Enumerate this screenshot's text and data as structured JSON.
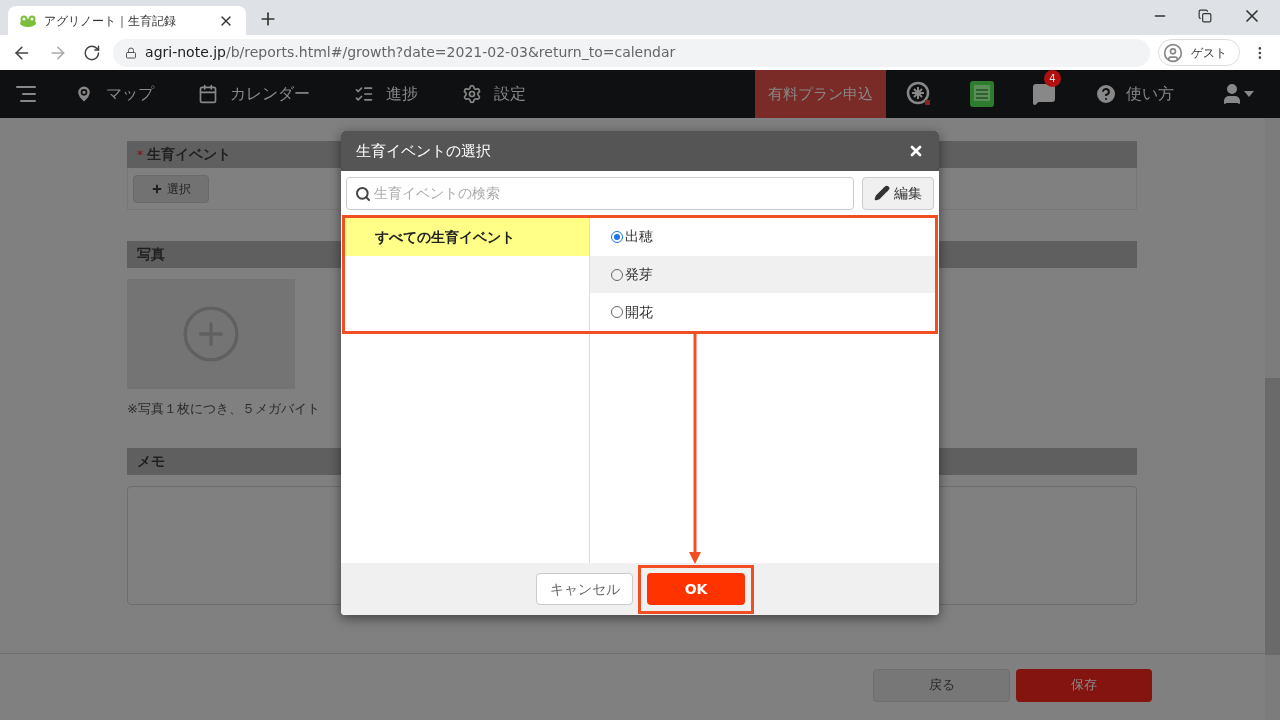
{
  "browser": {
    "tab_title": "アグリノート｜生育記録",
    "url_host": "agri-note.jp",
    "url_path": "/b/reports.html#/growth?date=2021-02-03&return_to=calendar",
    "profile": "ゲスト"
  },
  "nav": {
    "items": [
      {
        "label": "マップ",
        "kind": "map"
      },
      {
        "label": "カレンダー",
        "kind": "calendar"
      },
      {
        "label": "進捗",
        "kind": "progress"
      },
      {
        "label": "設定",
        "kind": "settings"
      }
    ],
    "upgrade": "有料プラン申込",
    "message_count": "4",
    "help": "使い方"
  },
  "form": {
    "event_section": {
      "title": "生育イベント",
      "required_mark": "*",
      "select_button": "選択"
    },
    "photo_section": {
      "title": "写真",
      "note": "※写真１枚につき、５メガバイト"
    },
    "memo_section": {
      "title": "メモ"
    },
    "back_button": "戻る",
    "save_button": "保存"
  },
  "modal": {
    "title": "生育イベントの選択",
    "search_placeholder": "生育イベントの検索",
    "edit_button": "編集",
    "categories": [
      {
        "label": "すべての生育イベント",
        "selected": true
      }
    ],
    "events": [
      {
        "label": "出穂",
        "selected": true,
        "hovered": false
      },
      {
        "label": "発芽",
        "selected": false,
        "hovered": true
      },
      {
        "label": "開花",
        "selected": false,
        "hovered": false
      }
    ],
    "cancel_button": "キャンセル",
    "ok_button": "OK"
  }
}
